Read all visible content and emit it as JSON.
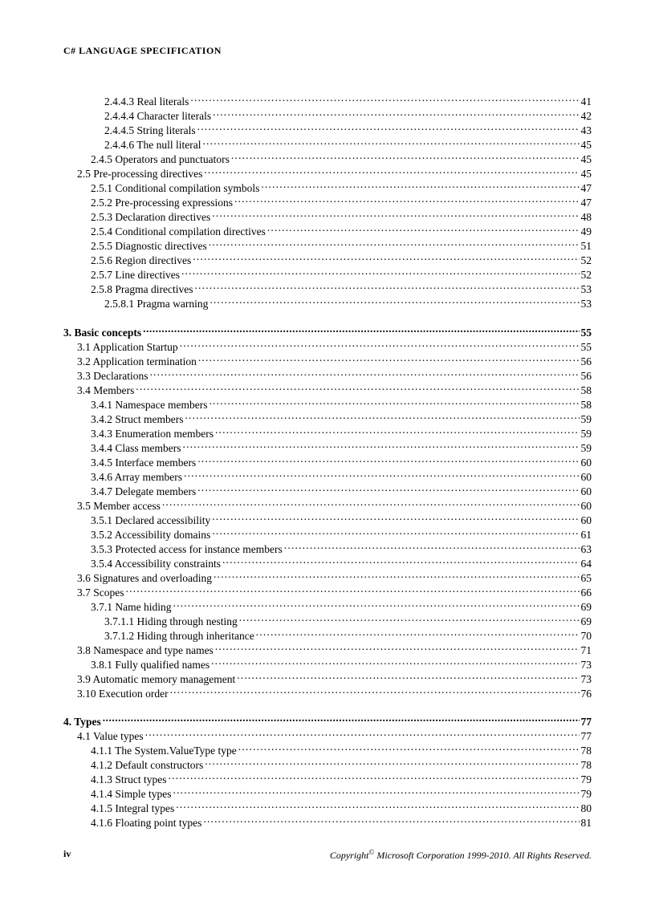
{
  "header": "C# LANGUAGE   SPECIFICATION",
  "footer": {
    "pageNumber": "iv",
    "copyright_prefix": "Copyright",
    "copyright_symbol": "©",
    "copyright_suffix": "  Microsoft Corporation 1999-2010. All Rights Reserved."
  },
  "sections": [
    {
      "entries": [
        {
          "indent": 3,
          "label": "2.4.4.3 Real literals",
          "page": "41"
        },
        {
          "indent": 3,
          "label": "2.4.4.4 Character literals",
          "page": "42"
        },
        {
          "indent": 3,
          "label": "2.4.4.5 String literals",
          "page": "43"
        },
        {
          "indent": 3,
          "label": "2.4.4.6 The null literal",
          "page": "45"
        },
        {
          "indent": 2,
          "label": "2.4.5 Operators and punctuators",
          "page": "45"
        },
        {
          "indent": 1,
          "label": "2.5 Pre-processing directives",
          "page": "45"
        },
        {
          "indent": 2,
          "label": "2.5.1 Conditional  compilation  symbols",
          "page": "47"
        },
        {
          "indent": 2,
          "label": "2.5.2 Pre-processing expressions",
          "page": "47"
        },
        {
          "indent": 2,
          "label": "2.5.3 Declaration directives",
          "page": "48"
        },
        {
          "indent": 2,
          "label": "2.5.4 Conditional  compilation directives",
          "page": "49"
        },
        {
          "indent": 2,
          "label": "2.5.5 Diagnostic directives",
          "page": "51"
        },
        {
          "indent": 2,
          "label": "2.5.6 Region directives",
          "page": "52"
        },
        {
          "indent": 2,
          "label": "2.5.7 Line directives",
          "page": "52"
        },
        {
          "indent": 2,
          "label": "2.5.8 Pragma directives",
          "page": "53"
        },
        {
          "indent": 3,
          "label": "2.5.8.1 Pragma warning",
          "page": "53"
        }
      ]
    },
    {
      "entries": [
        {
          "indent": 0,
          "label": "3. Basic concepts",
          "page": "55",
          "bold": true
        },
        {
          "indent": 1,
          "label": "3.1 Application  Startup",
          "page": "55"
        },
        {
          "indent": 1,
          "label": "3.2 Application  termination",
          "page": "56"
        },
        {
          "indent": 1,
          "label": "3.3 Declarations",
          "page": "56"
        },
        {
          "indent": 1,
          "label": "3.4 Members",
          "page": "58"
        },
        {
          "indent": 2,
          "label": "3.4.1 Namespace members",
          "page": "58"
        },
        {
          "indent": 2,
          "label": "3.4.2 Struct members",
          "page": "59"
        },
        {
          "indent": 2,
          "label": "3.4.3 Enumeration members",
          "page": "59"
        },
        {
          "indent": 2,
          "label": "3.4.4 Class members",
          "page": "59"
        },
        {
          "indent": 2,
          "label": "3.4.5 Interface members",
          "page": "60"
        },
        {
          "indent": 2,
          "label": "3.4.6 Array members",
          "page": "60"
        },
        {
          "indent": 2,
          "label": "3.4.7 Delegate members",
          "page": "60"
        },
        {
          "indent": 1,
          "label": "3.5 Member access",
          "page": "60"
        },
        {
          "indent": 2,
          "label": "3.5.1 Declared accessibility",
          "page": "60"
        },
        {
          "indent": 2,
          "label": "3.5.2 Accessibility domains",
          "page": "61"
        },
        {
          "indent": 2,
          "label": "3.5.3 Protected access for instance members",
          "page": "63"
        },
        {
          "indent": 2,
          "label": "3.5.4 Accessibility constraints",
          "page": "64"
        },
        {
          "indent": 1,
          "label": "3.6 Signatures  and overloading",
          "page": "65"
        },
        {
          "indent": 1,
          "label": "3.7 Scopes",
          "page": "66"
        },
        {
          "indent": 2,
          "label": "3.7.1 Name hiding",
          "page": "69"
        },
        {
          "indent": 3,
          "label": "3.7.1.1 Hiding  through nesting",
          "page": "69"
        },
        {
          "indent": 3,
          "label": "3.7.1.2 Hiding  through inheritance",
          "page": "70"
        },
        {
          "indent": 1,
          "label": "3.8 Namespace and type names",
          "page": "71"
        },
        {
          "indent": 2,
          "label": "3.8.1 Fully qualified  names",
          "page": "73"
        },
        {
          "indent": 1,
          "label": "3.9 Automatic memory management",
          "page": "73"
        },
        {
          "indent": 1,
          "label": "3.10 Execution order",
          "page": "76"
        }
      ]
    },
    {
      "entries": [
        {
          "indent": 0,
          "label": "4. Types",
          "page": "77",
          "bold": true
        },
        {
          "indent": 1,
          "label": "4.1 Value types",
          "page": "77"
        },
        {
          "indent": 2,
          "label": "4.1.1 The System.ValueType type",
          "page": "78"
        },
        {
          "indent": 2,
          "label": "4.1.2 Default constructors",
          "page": "78"
        },
        {
          "indent": 2,
          "label": "4.1.3 Struct types",
          "page": "79"
        },
        {
          "indent": 2,
          "label": "4.1.4 Simple types",
          "page": "79"
        },
        {
          "indent": 2,
          "label": "4.1.5 Integral types",
          "page": "80"
        },
        {
          "indent": 2,
          "label": "4.1.6 Floating point types",
          "page": "81"
        }
      ]
    }
  ]
}
